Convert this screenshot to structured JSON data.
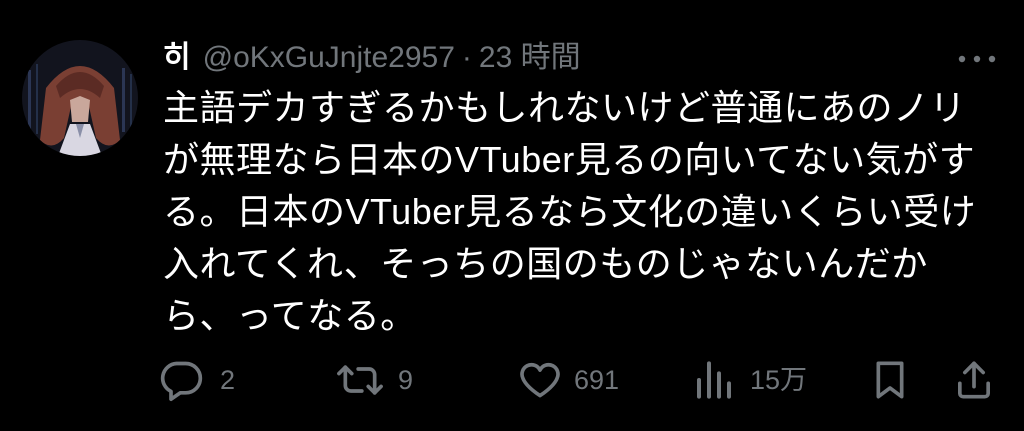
{
  "colors": {
    "background": "#000000",
    "primary_text": "#ffffff",
    "secondary_text": "#71767b"
  },
  "tweet": {
    "author": {
      "display_name": "히",
      "handle": "@oKxGuJnjte2957",
      "separator": "·",
      "time": "23 時間",
      "avatar_icon": "avatar-image"
    },
    "more_icon": "more-icon",
    "lines": [
      "主語デカすぎるかもしれないけど普通にあのノリ",
      "が無理なら日本のVTuber見るの向いてない気がす",
      "る。日本のVTuber見るなら文化の違いくらい受け",
      "入れてくれ、そっちの国のものじゃないんだか",
      "ら、ってなる。"
    ],
    "actions": {
      "reply": {
        "icon": "reply-icon",
        "count": "2"
      },
      "retweet": {
        "icon": "retweet-icon",
        "count": "9"
      },
      "like": {
        "icon": "heart-icon",
        "count": "691"
      },
      "views": {
        "icon": "views-icon",
        "count": "15万"
      },
      "bookmark": {
        "icon": "bookmark-icon"
      },
      "share": {
        "icon": "share-icon"
      }
    }
  }
}
